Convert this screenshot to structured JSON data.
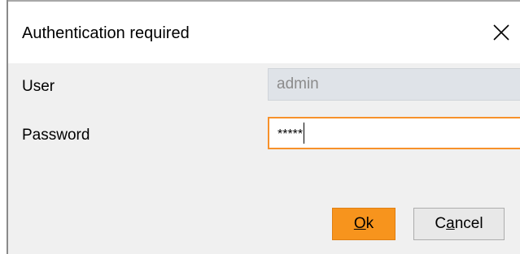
{
  "dialog": {
    "title": "Authentication required",
    "close_icon": "close-icon"
  },
  "form": {
    "user_label": "User",
    "user_value": "admin",
    "password_label": "Password",
    "password_value": "*****"
  },
  "buttons": {
    "ok_mnemonic": "O",
    "ok_rest": "k",
    "cancel_pre": "C",
    "cancel_mnemonic": "a",
    "cancel_rest": "ncel"
  },
  "colors": {
    "accent": "#f7941d",
    "focus_border": "#f7912a",
    "disabled_field": "#dfe3e8",
    "dialog_body": "#f0f0f0"
  }
}
